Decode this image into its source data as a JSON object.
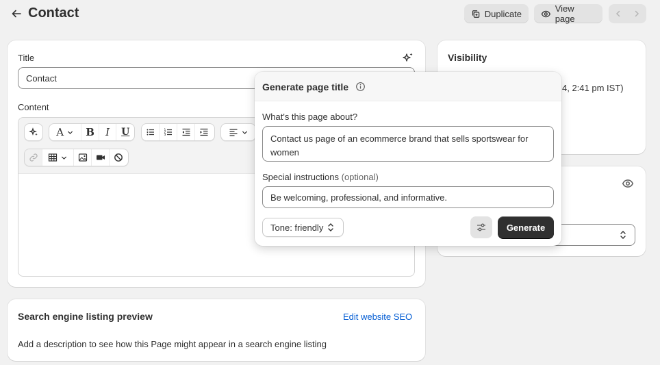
{
  "header": {
    "title": "Contact",
    "duplicate_label": "Duplicate",
    "view_page_label": "View page"
  },
  "main": {
    "title_label": "Title",
    "title_value": "Contact",
    "content_label": "Content"
  },
  "seo": {
    "heading": "Search engine listing preview",
    "edit_link": "Edit website SEO",
    "description": "Add a description to see how this Page might appear in a search engine listing"
  },
  "visibility": {
    "heading": "Visibility",
    "partial_text": "4, 2:41 pm IST)"
  },
  "generate_popover": {
    "title": "Generate page title",
    "about_label": "What's this page about?",
    "about_value": "Contact us page of an ecommerce brand that sells sportswear for women",
    "special_label": "Special instructions",
    "optional_label": "(optional)",
    "special_value": "Be welcoming, professional, and informative.",
    "tone_label": "Tone: friendly",
    "generate_label": "Generate"
  }
}
